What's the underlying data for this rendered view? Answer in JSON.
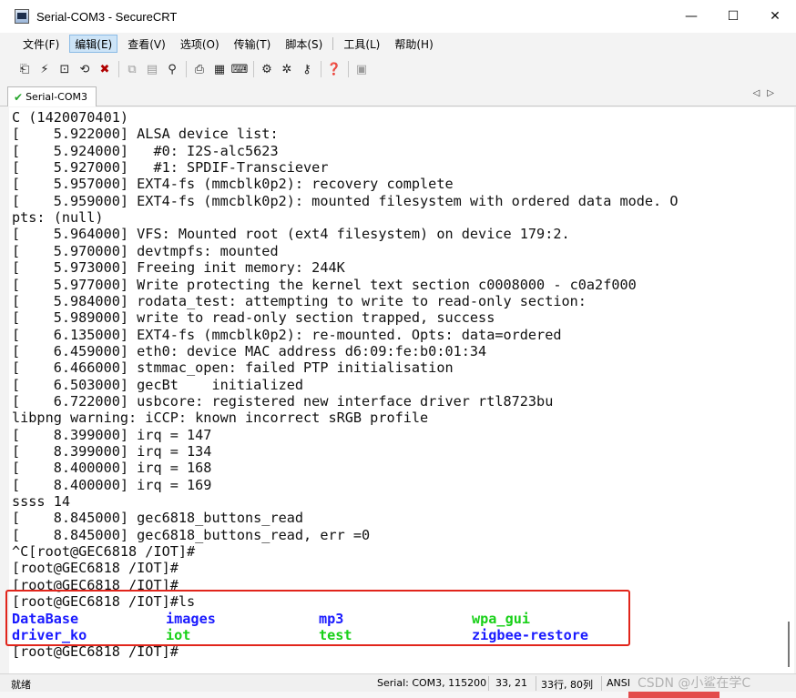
{
  "window": {
    "title": "Serial-COM3 - SecureCRT",
    "minimize_glyph": "—",
    "maximize_glyph": "☐",
    "close_glyph": "✕"
  },
  "menu": [
    {
      "label": "文件(F)"
    },
    {
      "label": "编辑(E)"
    },
    {
      "label": "查看(V)"
    },
    {
      "label": "选项(O)"
    },
    {
      "label": "传输(T)"
    },
    {
      "label": "脚本(S)"
    },
    {
      "label": "工具(L)"
    },
    {
      "label": "帮助(H)"
    }
  ],
  "toolbar": {
    "icons": [
      "connect-icon",
      "quick-connect-icon",
      "connect-in-tab-icon",
      "reconnect-icon",
      "disconnect-icon",
      "copy-icon",
      "paste-icon",
      "find-icon",
      "print-icon",
      "print-setup-icon",
      "print-selection-icon",
      "session-options-icon",
      "global-options-icon",
      "keymap-icon",
      "help-icon",
      "sftp-icon"
    ]
  },
  "tab": {
    "label": "Serial-COM3",
    "check_glyph": "✔",
    "nav_arrows": "◁▷"
  },
  "terminal": {
    "lines": [
      "C (1420070401)",
      "[    5.922000] ALSA device list:",
      "[    5.924000]   #0: I2S-alc5623",
      "[    5.927000]   #1: SPDIF-Transciever",
      "[    5.957000] EXT4-fs (mmcblk0p2): recovery complete",
      "[    5.959000] EXT4-fs (mmcblk0p2): mounted filesystem with ordered data mode. O",
      "pts: (null)",
      "[    5.964000] VFS: Mounted root (ext4 filesystem) on device 179:2.",
      "[    5.970000] devtmpfs: mounted",
      "[    5.973000] Freeing init memory: 244K",
      "[    5.977000] Write protecting the kernel text section c0008000 - c0a2f000",
      "[    5.984000] rodata_test: attempting to write to read-only section:",
      "[    5.989000] write to read-only section trapped, success",
      "[    6.135000] EXT4-fs (mmcblk0p2): re-mounted. Opts: data=ordered",
      "[    6.459000] eth0: device MAC address d6:09:fe:b0:01:34",
      "[    6.466000] stmmac_open: failed PTP initialisation",
      "[    6.503000] gecBt    initialized",
      "[    6.722000] usbcore: registered new interface driver rtl8723bu",
      "libpng warning: iCCP: known incorrect sRGB profile",
      "[    8.399000] irq = 147",
      "[    8.399000] irq = 134",
      "[    8.400000] irq = 168",
      "[    8.400000] irq = 169",
      "ssss 14",
      "[    8.845000] gec6818_buttons_read",
      "[    8.845000] gec6818_buttons_read, err =0",
      "^C[root@GEC6818 /IOT]#",
      "[root@GEC6818 /IOT]#",
      "[root@GEC6818 /IOT]#",
      "[root@GEC6818 /IOT]#ls"
    ],
    "ls_output": [
      {
        "name": "DataBase",
        "color": "#1a1aff"
      },
      {
        "name": "images",
        "color": "#1a1aff"
      },
      {
        "name": "mp3",
        "color": "#1a1aff"
      },
      {
        "name": "wpa_gui",
        "color": "#18d018"
      },
      {
        "name": "driver_ko",
        "color": "#1a1aff"
      },
      {
        "name": "iot",
        "color": "#18d018"
      },
      {
        "name": "test",
        "color": "#18d018"
      },
      {
        "name": "zigbee-restore",
        "color": "#1a1aff"
      }
    ],
    "last_prompt": "[root@GEC6818 /IOT]#"
  },
  "statusbar": {
    "left": "就绪",
    "connection": "Serial: COM3, 115200",
    "cursor": "33,  21",
    "size": "33行, 80列",
    "encoding": "ANSI"
  },
  "watermark": "CSDN @小鲨在学C",
  "colors": {
    "highlight_border": "#e1251b",
    "dir_blue": "#1a1aff",
    "exec_green": "#18d018"
  }
}
